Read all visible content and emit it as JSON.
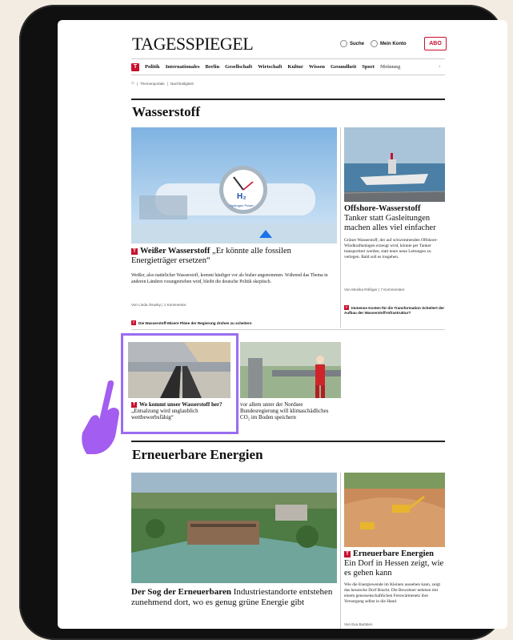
{
  "header": {
    "logo": "TAGESSPIEGEL",
    "search_label": "Suche",
    "account_label": "Mein Konto",
    "abo_label": "ABO"
  },
  "nav": {
    "badge": "T",
    "items": [
      "Politik",
      "Internationales",
      "Berlin",
      "Gesellschaft",
      "Wirtschaft",
      "Kultur",
      "Wissen",
      "Gesundheit",
      "Sport",
      "Meinung"
    ]
  },
  "breadcrumb": [
    "Themenportale",
    "Nachhaltigkeit"
  ],
  "section1": {
    "title": "Wasserstoff",
    "image_label": "Hydrogen Power",
    "image_symbol": "H₂",
    "main": {
      "kicker": "Weißer Wasserstoff",
      "headline": "„Er könnte alle fossilen Energieträger ersetzen“",
      "teaser": "Weißer, also natürlicher Wasserstoff, kommt häufiger vor als bisher angenommen. Während das Thema in anderen Ländern vorangetrieben wird, bleibt die deutsche Politik skeptisch.",
      "author": "Von Linda Osusky",
      "comments": "1 Kommentar",
      "related": "Die Wasserstoff-Misere Pläne der Regierung drohen zu scheitern"
    },
    "side": {
      "kicker": "Offshore-Wasserstoff",
      "headline": "Tanker statt Gasleitungen machen alles viel einfacher",
      "teaser": "Grüner Wasserstoff, der auf schwimmenden Offshore-Windkraftanlagen erzeugt wird, könnte per Tanker transportiert werden, statt teure neue Leitungen zu verlegen. Bald soll es losgehen.",
      "author": "Von Monika Rößiger",
      "comments": "7 Kommentare",
      "related": "Immense Kosten für die Transformation Scheitert der Aufbau der Wasserstoff-Infrastruktur?"
    },
    "small1": {
      "kicker": "Wo kommt unser Wasserstoff her?",
      "headline": "„Entsalzung wird unglaublich wettbewerbsfähig“"
    },
    "small2": {
      "text": "vor allem unter der Nordsee Bundesregierung will klimaschädliches CO₂ im Boden speichern"
    }
  },
  "section2": {
    "title": "Erneuerbare Energien",
    "main": {
      "kicker": "Der Sog der Erneuerbaren",
      "headline": "Industriestandorte entstehen zunehmend dort, wo es genug grüne Energie gibt"
    },
    "side": {
      "kicker": "Erneuerbare Energien",
      "headline": "Ein Dorf in Hessen zeigt, wie es gehen kann",
      "teaser": "Wie die Energiewende im Kleinen aussehen kann, zeigt das hessische Dorf Bracht. Die Bewohner nehmen mit einem genossenschaftlichen Fernwärmenetz ihre Versorgung selbst in die Hand.",
      "author": "Von Eva Bartsten"
    }
  },
  "colors": {
    "brand_red": "#c8102e",
    "highlight": "#9b6cf0"
  }
}
